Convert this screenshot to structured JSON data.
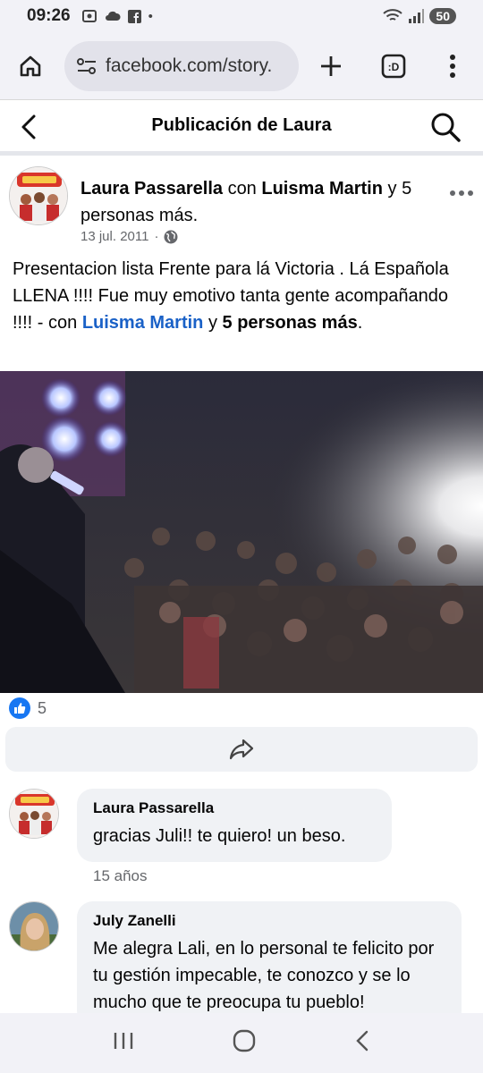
{
  "status": {
    "time": "09:26",
    "battery": "50"
  },
  "browser": {
    "url": "facebook.com/story."
  },
  "header": {
    "title": "Publicación de Laura"
  },
  "post": {
    "author": "Laura Passarella",
    "with_word": "con",
    "tagged": "Luisma Martin",
    "and_word": "y",
    "others": "5 personas más.",
    "date": "13 jul. 2011",
    "dot": "·",
    "text_part1": "Presentacion lista Frente para lá Victoria . Lá Española LLENA !!!! Fue muy emotivo tanta gente acompañando !!!! - con ",
    "text_link": "Luisma Martin",
    "text_and": " y ",
    "text_others": "5 personas más",
    "text_end": ".",
    "likes": "5"
  },
  "comments": [
    {
      "name": "Laura Passarella",
      "text": "gracias Juli!! te quiero! un beso.",
      "time": "15 años"
    },
    {
      "name": "July Zanelli",
      "text": "Me alegra Lali, en lo personal te felicito por tu gestión impecable, te conozco y se lo mucho que te preocupa tu pueblo!"
    }
  ],
  "colors": {
    "link": "#1a61c7",
    "like": "#1877f2",
    "bubble": "#f0f2f5"
  }
}
